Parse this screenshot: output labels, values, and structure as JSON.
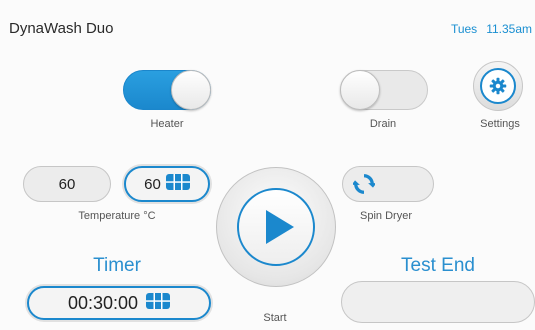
{
  "app": {
    "title": "DynaWash Duo"
  },
  "clock": {
    "day": "Tues",
    "time": "11.35am"
  },
  "heater": {
    "label": "Heater",
    "state": "on"
  },
  "drain": {
    "label": "Drain",
    "state": "off"
  },
  "settings": {
    "label": "Settings",
    "icon": "gear-icon"
  },
  "temperature": {
    "current": "60",
    "setpoint": "60",
    "label": "Temperature °C",
    "setpoint_icon": "keypad-icon"
  },
  "spin_dryer": {
    "label": "Spin Dryer",
    "icon": "rotate-arrows-icon"
  },
  "start": {
    "label": "Start",
    "icon": "play-icon"
  },
  "timer": {
    "title": "Timer",
    "value": "00:30:00",
    "icon": "keypad-icon"
  },
  "test_end": {
    "title": "Test End",
    "value": ""
  },
  "colors": {
    "accent": "#1b88cd",
    "accent_text": "#2a8fcf",
    "background": "#fbfbfb"
  }
}
